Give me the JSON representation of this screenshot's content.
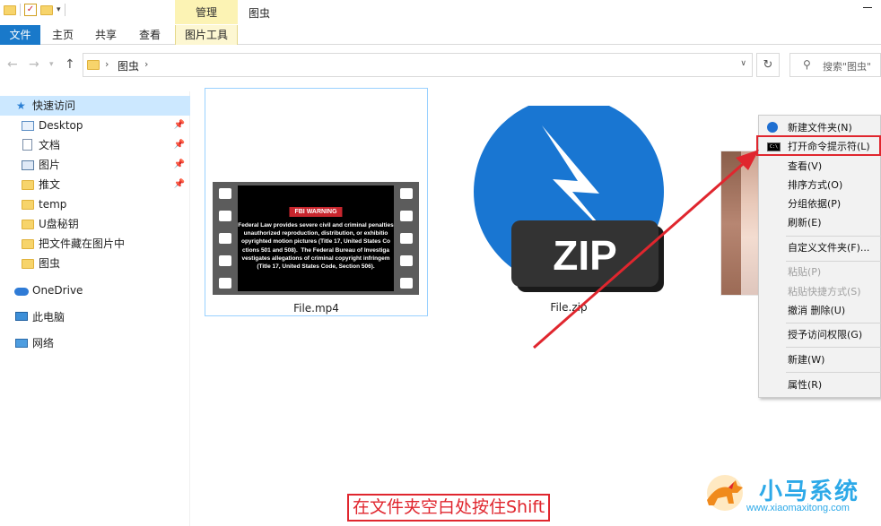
{
  "window": {
    "manage_tab": "管理",
    "title": "图虫"
  },
  "ribbon": {
    "tabs": [
      "文件",
      "主页",
      "共享",
      "查看",
      "图片工具"
    ]
  },
  "address": {
    "crumb": "图虫",
    "search_placeholder": "搜索\"图虫\""
  },
  "navpane": {
    "items": [
      {
        "label": "快速访问",
        "icon": "star-icon",
        "pinned": false,
        "selected": true
      },
      {
        "label": "Desktop",
        "icon": "desktop-icon",
        "pinned": true
      },
      {
        "label": "文档",
        "icon": "document-icon",
        "pinned": true
      },
      {
        "label": "图片",
        "icon": "pictures-icon",
        "pinned": true
      },
      {
        "label": "推文",
        "icon": "folder-icon",
        "pinned": true
      },
      {
        "label": "temp",
        "icon": "folder-icon",
        "pinned": false
      },
      {
        "label": "U盘秘钥",
        "icon": "folder-icon",
        "pinned": false
      },
      {
        "label": "把文件藏在图片中",
        "icon": "folder-icon",
        "pinned": false
      },
      {
        "label": "图虫",
        "icon": "folder-icon",
        "pinned": false
      },
      {
        "label": "OneDrive",
        "icon": "cloud-icon",
        "pinned": false
      },
      {
        "label": "此电脑",
        "icon": "computer-icon",
        "pinned": false
      },
      {
        "label": "网络",
        "icon": "network-icon",
        "pinned": false
      }
    ],
    "pin_glyph": "📌"
  },
  "files": [
    {
      "name": "File.mp4",
      "type": "video"
    },
    {
      "name": "File.zip",
      "type": "zip"
    }
  ],
  "video_thumb": {
    "banner": "FBI WARNING",
    "body": "Federal Law provides severe civil and criminal penalties\nunauthorized reproduction, distribution, or exhibitio\nopyrighted motion pictures (Title 17, United States Co\nctions 501 and 508).  The Federal Bureau of Investiga\nvestigates allegations of criminal copyright infringem\n(Title 17, United States Code, Section 506)."
  },
  "zip_icon": {
    "text": "ZIP"
  },
  "context_menu": {
    "items": [
      {
        "label": "新建文件夹(N)",
        "icon": "new-folder-icon",
        "disabled": false
      },
      {
        "label": "打开命令提示符(L)",
        "icon": "cmd-icon",
        "disabled": false,
        "highlighted": true
      },
      {
        "label": "查看(V)",
        "disabled": false
      },
      {
        "label": "排序方式(O)",
        "disabled": false
      },
      {
        "label": "分组依据(P)",
        "disabled": false
      },
      {
        "label": "刷新(E)",
        "disabled": false
      },
      {
        "label": "自定义文件夹(F)...",
        "disabled": false
      },
      {
        "label": "粘贴(P)",
        "disabled": true
      },
      {
        "label": "粘贴快捷方式(S)",
        "disabled": true
      },
      {
        "label": "撤消 删除(U)",
        "disabled": false
      },
      {
        "label": "授予访问权限(G)",
        "disabled": false
      },
      {
        "label": "新建(W)",
        "disabled": false
      },
      {
        "label": "属性(R)",
        "disabled": false
      }
    ]
  },
  "caption": "在文件夹空白处按住Shift",
  "watermark": {
    "brand": "小马系统",
    "url": "www.xiaomaxitong.com"
  },
  "colors": {
    "accent": "#1979ca",
    "selection": "#cce8ff",
    "annotation_red": "#e0262e",
    "zip_blue": "#1976d2"
  }
}
